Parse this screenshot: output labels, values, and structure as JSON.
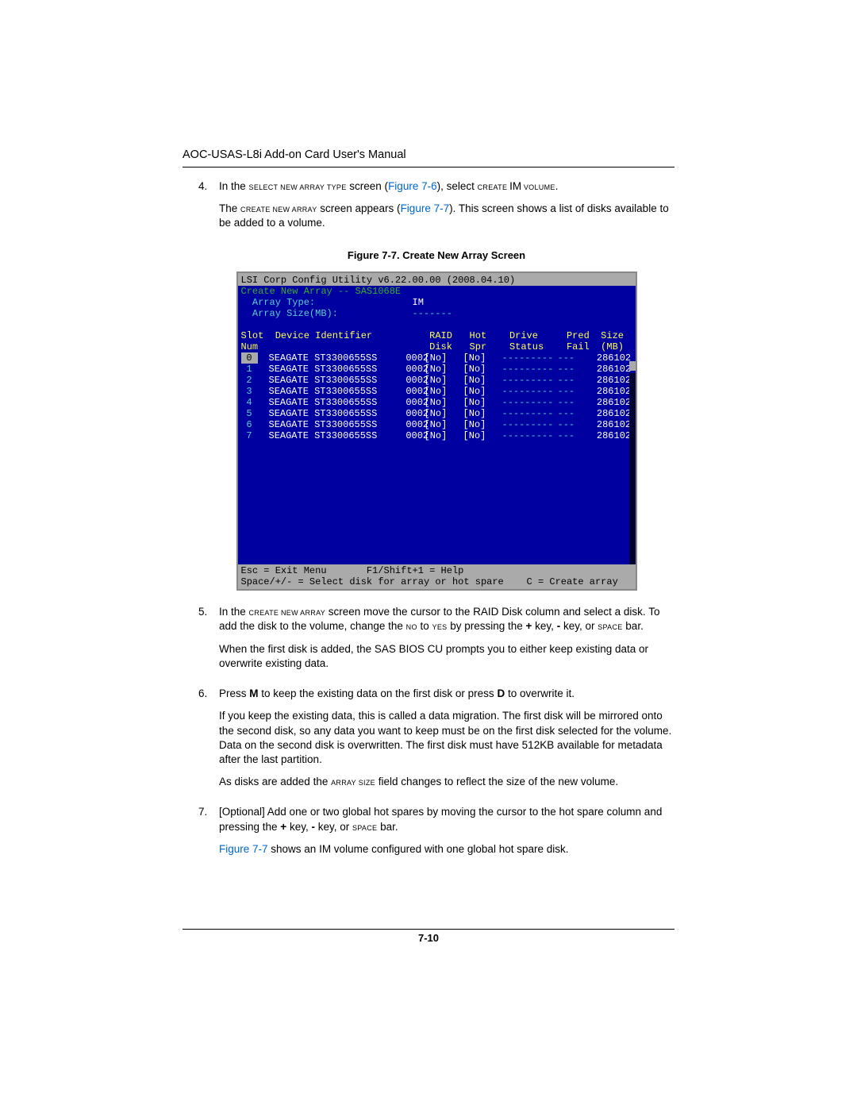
{
  "header": {
    "title": "AOC-USAS-L8i Add-on Card User's Manual"
  },
  "figure": {
    "caption": "Figure 7-7. Create New Array Screen",
    "refA": "Figure 7-6",
    "refB": "Figure 7-7"
  },
  "steps": {
    "s4n": "4.",
    "s4a": "In the ",
    "s4b": "Select New Array Type",
    "s4c": " screen (",
    "s4d": "), select ",
    "s4e": "Create ",
    "s4f": "IM",
    "s4g": " Volume",
    "s4h": ".",
    "s4p2a": "The ",
    "s4p2b": "Create New Array",
    "s4p2c": " screen appears (",
    "s4p2d": "). This screen shows a list of disks available to be added to a volume.",
    "s5n": "5.",
    "s5a": "In the ",
    "s5b": "Create New Array",
    "s5c": " screen move the cursor to the RAID Disk column and select a disk. To add the disk to the volume, change the ",
    "s5d": "No",
    "s5e": " to ",
    "s5f": "Yes",
    "s5g": " by pressing the ",
    "s5h": "+",
    "s5i": " key, ",
    "s5j": "-",
    "s5k": " key, or ",
    "s5l": "space",
    "s5m": " bar.",
    "s5p2": "When the first disk is added, the SAS BIOS CU prompts you to either keep existing data or overwrite existing data.",
    "s6n": "6.",
    "s6a": "Press ",
    "s6b": "M",
    "s6c": " to keep the existing data on the first disk or press ",
    "s6d": "D",
    "s6e": " to overwrite it.",
    "s6p2": "If you keep the existing data, this is called a data migration. The first disk will be mirrored onto the second disk, so any data you want to keep must be on the first disk selected for the volume. Data on the second disk is overwritten. The first disk must have 512KB available for metadata after the last partition.",
    "s6p3a": "As disks are added the ",
    "s6p3b": "Array Size",
    "s6p3c": " field changes to reflect the size of the new volume.",
    "s7n": "7.",
    "s7a": "[Optional] Add one or two global hot spares by moving the cursor to the hot spare column and pressing the ",
    "s7b": "+",
    "s7c": " key, ",
    "s7d": "-",
    "s7e": " key, or ",
    "s7f": "space",
    "s7g": " bar.",
    "s7p2b": " shows an IM volume configured with one global hot spare disk."
  },
  "pagenum": "7-10",
  "bios": {
    "title": "LSI Corp Config Utility    v6.22.00.00 (2008.04.10)",
    "sub": "Create New Array -- SAS1068E",
    "arrtype_l": "  Array Type:",
    "arrtype_v": "IM",
    "arrsize_l": "  Array Size(MB):",
    "arrsize_v": "-------",
    "hdr1": "Slot  Device Identifier          RAID   Hot    Drive     Pred  Size",
    "hdr2": "Num                              Disk   Spr    Status    Fail  (MB)",
    "rows": [
      {
        "slot": "0",
        "id": "SEAGATE ST3300655SS     0002",
        "raid": "[No]",
        "hot": "[No]",
        "drv": "---------",
        "pred": "---",
        "size": "  286102"
      },
      {
        "slot": "1",
        "id": "SEAGATE ST3300655SS     0002",
        "raid": "[No]",
        "hot": "[No]",
        "drv": "---------",
        "pred": "---",
        "size": "  286102"
      },
      {
        "slot": "2",
        "id": "SEAGATE ST3300655SS     0002",
        "raid": "[No]",
        "hot": "[No]",
        "drv": "---------",
        "pred": "---",
        "size": "  286102"
      },
      {
        "slot": "3",
        "id": "SEAGATE ST3300655SS     0002",
        "raid": "[No]",
        "hot": "[No]",
        "drv": "---------",
        "pred": "---",
        "size": "  286102"
      },
      {
        "slot": "4",
        "id": "SEAGATE ST3300655SS     0002",
        "raid": "[No]",
        "hot": "[No]",
        "drv": "---------",
        "pred": "---",
        "size": "  286102"
      },
      {
        "slot": "5",
        "id": "SEAGATE ST3300655SS     0002",
        "raid": "[No]",
        "hot": "[No]",
        "drv": "---------",
        "pred": "---",
        "size": "  286102"
      },
      {
        "slot": "6",
        "id": "SEAGATE ST3300655SS     0002",
        "raid": "[No]",
        "hot": "[No]",
        "drv": "---------",
        "pred": "---",
        "size": "  286102"
      },
      {
        "slot": "7",
        "id": "SEAGATE ST3300655SS     0002",
        "raid": "[No]",
        "hot": "[No]",
        "drv": "---------",
        "pred": "---",
        "size": "  286102"
      }
    ],
    "foot1": "Esc = Exit Menu       F1/Shift+1 = Help",
    "foot2": "Space/+/- = Select disk for array or hot spare    C = Create array"
  }
}
